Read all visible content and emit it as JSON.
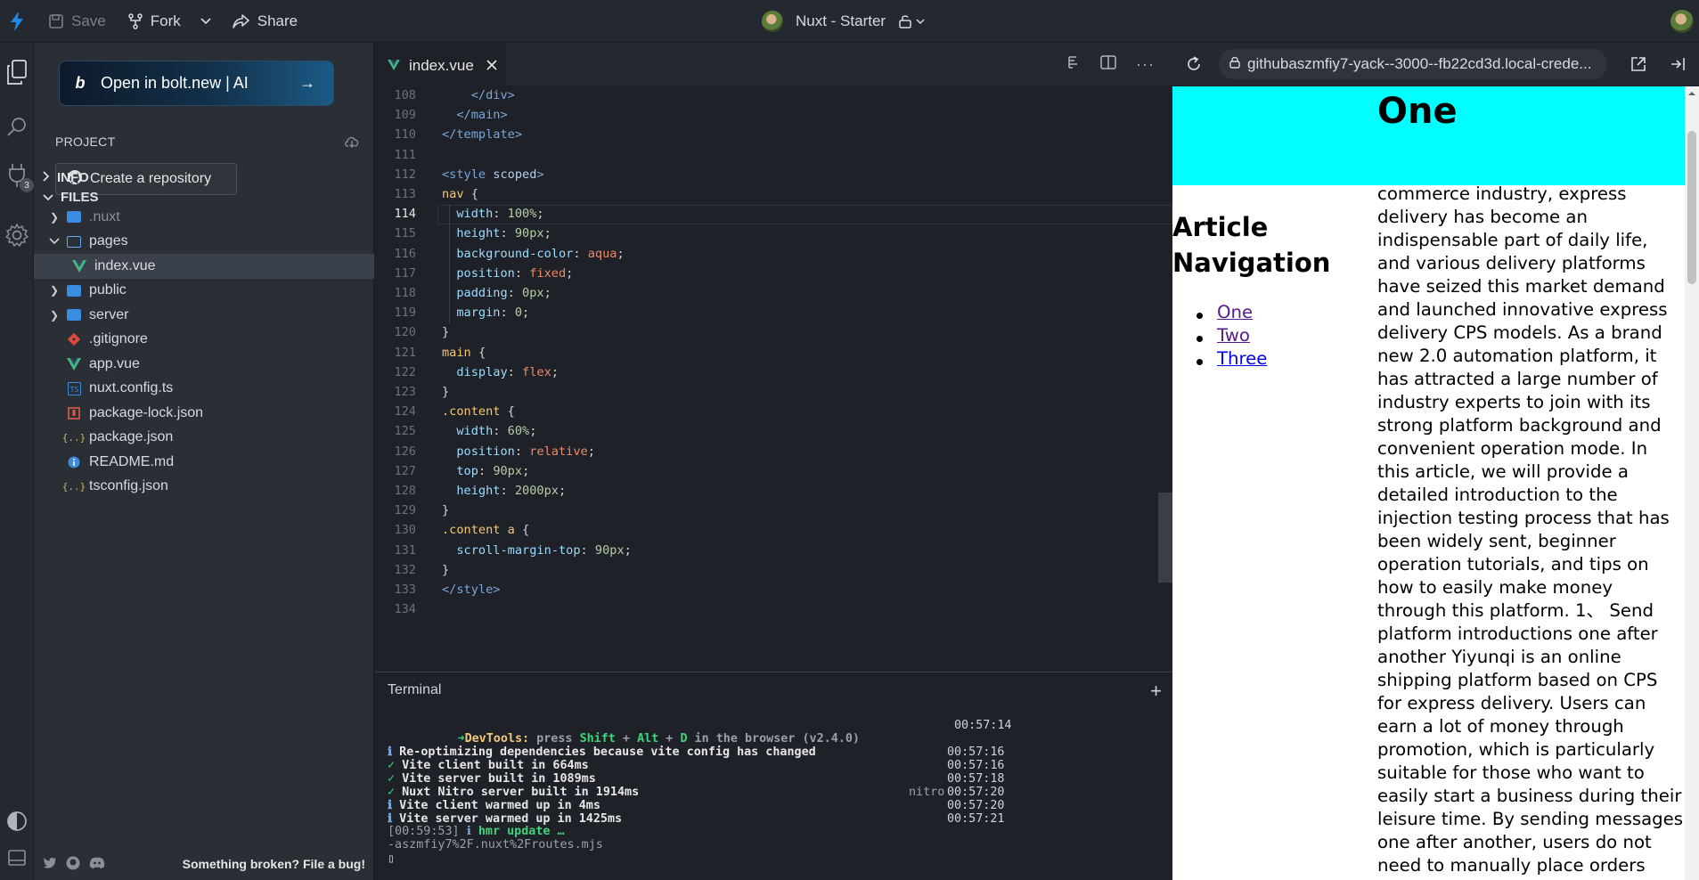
{
  "topbar": {
    "save": "Save",
    "fork": "Fork",
    "share": "Share",
    "title": "Nuxt - Starter"
  },
  "sidebar": {
    "open_bolt": "Open in bolt.new | AI",
    "project_label": "PROJECT",
    "create_repo": "Create a repository",
    "info_label": "INFO",
    "files_label": "FILES",
    "extensions_badge": "3",
    "files": [
      {
        "name": ".nuxt",
        "type": "folder"
      },
      {
        "name": "pages",
        "type": "folder-open"
      },
      {
        "name": "index.vue",
        "type": "vue"
      },
      {
        "name": "public",
        "type": "folder"
      },
      {
        "name": "server",
        "type": "folder"
      },
      {
        "name": ".gitignore",
        "type": "git"
      },
      {
        "name": "app.vue",
        "type": "vue"
      },
      {
        "name": "nuxt.config.ts",
        "type": "ts"
      },
      {
        "name": "package-lock.json",
        "type": "lock"
      },
      {
        "name": "package.json",
        "type": "json"
      },
      {
        "name": "README.md",
        "type": "info"
      },
      {
        "name": "tsconfig.json",
        "type": "json"
      }
    ],
    "footer_bug": "Something broken? File a bug!"
  },
  "editor": {
    "tab": "index.vue",
    "current_line": "114",
    "lines": [
      {
        "n": "108",
        "html": "    <span class='tk-tag'>&lt;/div&gt;</span>"
      },
      {
        "n": "109",
        "html": "  <span class='tk-tag'>&lt;/main&gt;</span>"
      },
      {
        "n": "110",
        "html": "<span class='tk-tag'>&lt;/template&gt;</span>"
      },
      {
        "n": "111",
        "html": ""
      },
      {
        "n": "112",
        "html": "<span class='tk-tag'>&lt;style</span> <span class='tk-attr'>scoped</span><span class='tk-tag'>&gt;</span>"
      },
      {
        "n": "113",
        "html": "<span class='tk-sel'>nav</span> <span class='tk-p'>{</span>"
      },
      {
        "n": "114",
        "html": "  <span class='tk-prop'>width</span><span class='tk-p'>: </span><span class='tk-num'>100%</span><span class='tk-p'>;</span>"
      },
      {
        "n": "115",
        "html": "  <span class='tk-prop'>height</span><span class='tk-p'>: </span><span class='tk-num'>90px</span><span class='tk-p'>;</span>"
      },
      {
        "n": "116",
        "html": "  <span class='tk-prop'>background-color</span><span class='tk-p'>: </span><span class='tk-kw'>aqua</span><span class='tk-p'>;</span>"
      },
      {
        "n": "117",
        "html": "  <span class='tk-prop'>position</span><span class='tk-p'>: </span><span class='tk-kw'>fixed</span><span class='tk-p'>;</span>"
      },
      {
        "n": "118",
        "html": "  <span class='tk-prop'>padding</span><span class='tk-p'>: </span><span class='tk-num'>0px</span><span class='tk-p'>;</span>"
      },
      {
        "n": "119",
        "html": "  <span class='tk-prop'>margin</span><span class='tk-p'>: </span><span class='tk-num'>0</span><span class='tk-p'>;</span>"
      },
      {
        "n": "120",
        "html": "<span class='tk-p'>}</span>"
      },
      {
        "n": "121",
        "html": "<span class='tk-sel'>main</span> <span class='tk-p'>{</span>"
      },
      {
        "n": "122",
        "html": "  <span class='tk-prop'>display</span><span class='tk-p'>: </span><span class='tk-kw'>flex</span><span class='tk-p'>;</span>"
      },
      {
        "n": "123",
        "html": "<span class='tk-p'>}</span>"
      },
      {
        "n": "124",
        "html": "<span class='tk-sel'>.content</span> <span class='tk-p'>{</span>"
      },
      {
        "n": "125",
        "html": "  <span class='tk-prop'>width</span><span class='tk-p'>: </span><span class='tk-num'>60%</span><span class='tk-p'>;</span>"
      },
      {
        "n": "126",
        "html": "  <span class='tk-prop'>position</span><span class='tk-p'>: </span><span class='tk-kw'>relative</span><span class='tk-p'>;</span>"
      },
      {
        "n": "127",
        "html": "  <span class='tk-prop'>top</span><span class='tk-p'>: </span><span class='tk-num'>90px</span><span class='tk-p'>;</span>"
      },
      {
        "n": "128",
        "html": "  <span class='tk-prop'>height</span><span class='tk-p'>: </span><span class='tk-num'>2000px</span><span class='tk-p'>;</span>"
      },
      {
        "n": "129",
        "html": "<span class='tk-p'>}</span>"
      },
      {
        "n": "130",
        "html": "<span class='tk-sel'>.content a</span> <span class='tk-p'>{</span>"
      },
      {
        "n": "131",
        "html": "  <span class='tk-prop'>scroll-margin-top</span><span class='tk-p'>: </span><span class='tk-num'>90px</span><span class='tk-p'>;</span>"
      },
      {
        "n": "132",
        "html": "<span class='tk-p'>}</span>"
      },
      {
        "n": "133",
        "html": "<span class='tk-tag'>&lt;/style&gt;</span>"
      },
      {
        "n": "134",
        "html": ""
      }
    ]
  },
  "terminal": {
    "title": "Terminal",
    "devtools": {
      "arrow": "➜",
      "label": "DevTools:",
      "rest": " press ",
      "k1": "Shift",
      "plus1": " + ",
      "k2": "Alt",
      "plus2": " + ",
      "k3": "D",
      "tail": " in the browser (v2.4.0)",
      "time": "00:57:14"
    },
    "lines": [
      {
        "icon": "ℹ",
        "text": "Re-optimizing dependencies because vite config has changed",
        "tag": "",
        "time": "00:57:16",
        "ok": false
      },
      {
        "icon": "✓",
        "text": "Vite client built in 664ms",
        "tag": "",
        "time": "00:57:16",
        "ok": true
      },
      {
        "icon": "✓",
        "text": "Vite server built in 1089ms",
        "tag": "",
        "time": "00:57:18",
        "ok": true
      },
      {
        "icon": "✓",
        "text": "Nuxt Nitro server built in 1914ms",
        "tag": "nitro",
        "time": "00:57:20",
        "ok": true
      },
      {
        "icon": "ℹ",
        "text": "Vite client warmed up in 4ms",
        "tag": "",
        "time": "00:57:20",
        "ok": false
      },
      {
        "icon": "ℹ",
        "text": "Vite server warmed up in 1425ms",
        "tag": "",
        "time": "00:57:21",
        "ok": false
      }
    ],
    "hmr_time": "[00:59:53]",
    "hmr_icon": "ℹ",
    "hmr_text": "hmr update …",
    "path_line": "-aszmfiy7%2F.nuxt%2Froutes.mjs",
    "cursor": "▯"
  },
  "preview": {
    "url": "githubaszmfiy7-yack--3000--fb22cd3d.local-crede...",
    "heading": "One",
    "paragraph": "With the development of the e-commerce industry, express delivery has become an indispensable part of daily life, and various delivery platforms have seized this market demand and launched innovative express delivery CPS models. As a brand new 2.0 automation platform, it has attracted a large number of industry experts to join with its strong platform background and convenient operation mode. In this article, we will provide a detailed introduction to the injection testing process that has been widely sent, beginner operation tutorials, and tips on how to easily make money through this platform. 1、 Send platform introductions one after another Yiyunqi is an online shipping platform based on CPS for express delivery. Users can earn a lot of money through promotion, which is particularly suitable for those who want to easily start a business during their leisure time. By sending messages one after another, users do not need to manually place orders themselves, they only need to become agents",
    "nav_title": "Article Navigation",
    "nav_links": [
      "One",
      "Two",
      "Three"
    ]
  },
  "colors": {
    "accent": "#1e88e5",
    "nav_bg": "#00ffff"
  }
}
